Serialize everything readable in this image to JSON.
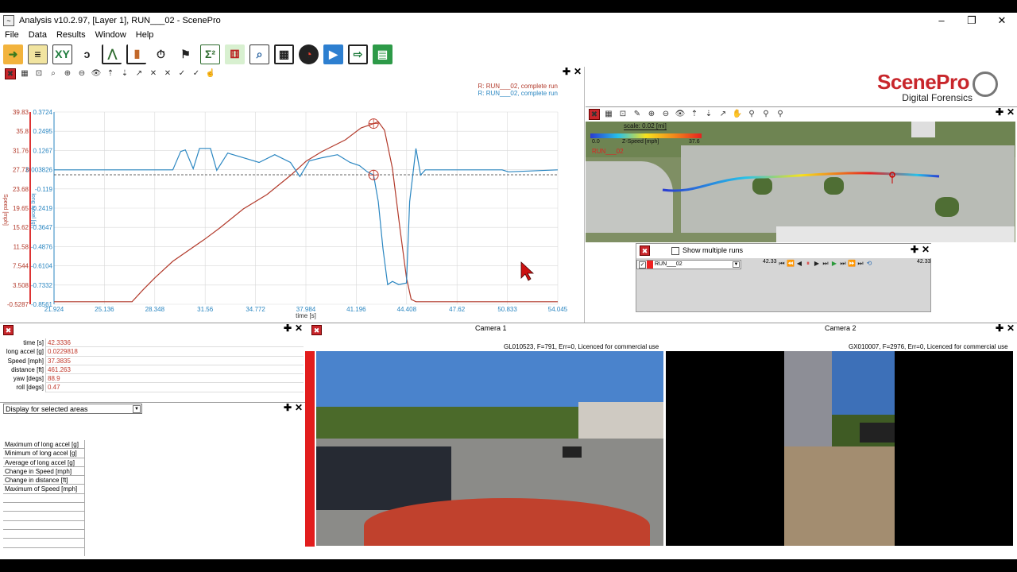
{
  "window": {
    "title": "Analysis v10.2.97, [Layer 1], RUN___02 - ScenePro",
    "buttons": [
      "–",
      "❐",
      "✕"
    ]
  },
  "menu": [
    "File",
    "Data",
    "Results",
    "Window",
    "Help"
  ],
  "toolbar_icons": [
    "open-folder-icon",
    "clipboard-icon",
    "xy-table-icon",
    "curve-icon",
    "line-chart-icon",
    "bar-chart-icon",
    "stopwatch-icon",
    "checkered-flag-icon",
    "sigma-icon",
    "dice-grid-icon",
    "chart-search-icon",
    "filmstrip-icon",
    "gauge-icon",
    "play-icon",
    "export-video-icon",
    "export-grid-icon"
  ],
  "chart": {
    "legend": [
      "R:  RUN___02, complete run",
      "R:  RUN___02, complete run"
    ],
    "xlabel": "time [s]",
    "ylabel_left": "Speed [mph]",
    "ylabel_mid": "long accel [g]",
    "x_ticks": [
      "21.924",
      "25.136",
      "28.348",
      "31.56",
      "34.772",
      "37.984",
      "41.196",
      "44.408",
      "47.62",
      "50.833",
      "54.045"
    ],
    "y_ticks_speed": [
      "39.83",
      "35.8",
      "31.76",
      "27.73",
      "23.68",
      "19.65",
      "15.62",
      "11.58",
      "7.544",
      "3.508",
      "-0.5287"
    ],
    "y_ticks_accel": [
      "0.3724",
      "0.2495",
      "0.1267",
      "0.003826",
      "-0.119",
      "-0.2419",
      "-0.3647",
      "-0.4876",
      "-0.6104",
      "-0.7332",
      "-0.8561"
    ]
  },
  "chart_data": {
    "type": "line",
    "xlim": [
      21.924,
      54.045
    ],
    "x_axis_label": "time [s]",
    "series": [
      {
        "name": "R:  RUN___02, complete run",
        "axis": "speed [mph]",
        "color": "#b23a2b",
        "ylim": [
          -0.5287,
          39.83
        ],
        "x": [
          21.924,
          26.9,
          27.6,
          28.35,
          29.5,
          31.56,
          32.5,
          34.0,
          35.5,
          37.0,
          38.0,
          39.0,
          40.5,
          41.5,
          42.3,
          42.6,
          43.0,
          43.5,
          44.0,
          44.4,
          44.7,
          45.0,
          54.045
        ],
        "y": [
          0,
          0,
          2.5,
          5.0,
          8.5,
          13.2,
          15.5,
          19.5,
          22.5,
          26.5,
          29.5,
          31.5,
          34.0,
          36.5,
          37.4,
          37.8,
          36.0,
          28.0,
          15.0,
          5.0,
          0.5,
          0,
          0
        ]
      },
      {
        "name": "R:  RUN___02, complete run",
        "axis": "long accel [g]",
        "color": "#2a86c1",
        "ylim": [
          -0.8561,
          0.3724
        ],
        "x": [
          21.924,
          29.5,
          30.0,
          30.3,
          30.8,
          31.2,
          31.9,
          32.3,
          33.0,
          34.0,
          35.0,
          36.0,
          37.0,
          37.6,
          38.2,
          39.0,
          40.0,
          40.8,
          41.4,
          41.9,
          42.3,
          42.6,
          42.9,
          43.2,
          43.5,
          43.9,
          44.4,
          44.6,
          45.0,
          45.3,
          45.6,
          46.0,
          50.5,
          50.9,
          54.045
        ],
        "y": [
          0.003,
          0.003,
          0.12,
          0.13,
          0.01,
          0.14,
          0.14,
          0.0,
          0.11,
          0.08,
          0.05,
          0.1,
          0.05,
          -0.04,
          0.06,
          0.08,
          0.1,
          0.05,
          0.03,
          -0.01,
          -0.03,
          -0.2,
          -0.5,
          -0.73,
          -0.71,
          -0.73,
          -0.72,
          -0.2,
          0.14,
          -0.03,
          0.003,
          0.003,
          0.003,
          -0.01,
          0.003
        ]
      }
    ],
    "markers": [
      {
        "x": 42.3,
        "series": 0
      },
      {
        "x": 42.3,
        "series": 1
      }
    ]
  },
  "logo": {
    "name": "ScenePro",
    "tagline": "Digital Forensics"
  },
  "map": {
    "scale": "scale: 0.02 [mi]",
    "legend_min": "0.0",
    "legend_label": "Z-Speed [mph]",
    "legend_max": "37.6",
    "run": "RUN___02"
  },
  "playback": {
    "show_multiple_runs": "Show multiple runs",
    "run_select": "RUN___02",
    "time_left": "42.33",
    "time_right": "42.33"
  },
  "values": {
    "rows": [
      {
        "key": "time [s]",
        "value": "42.3336"
      },
      {
        "key": "long accel [g]",
        "value": "0.0229818"
      },
      {
        "key": "Speed [mph]",
        "value": "37.3835"
      },
      {
        "key": "distance [ft]",
        "value": "461.263"
      },
      {
        "key": "yaw [degs]",
        "value": "88.9"
      },
      {
        "key": "roll [degs]",
        "value": "0.47"
      }
    ]
  },
  "stats": {
    "dropdown": "Display for selected areas",
    "rows": [
      "Maximum of long accel [g]",
      "Minimum of long accel [g]",
      "Average of long accel [g]",
      "Change in Speed [mph]",
      "Change in distance [ft]",
      "Maximum of Speed [mph]"
    ]
  },
  "cameras": [
    {
      "title": "Camera 1",
      "caption": "GL010523, F=791, Err=0, Licenced for commercial use"
    },
    {
      "title": "Camera 2",
      "caption": "GX010007, F=2976, Err=0, Licenced for commercial use"
    }
  ]
}
